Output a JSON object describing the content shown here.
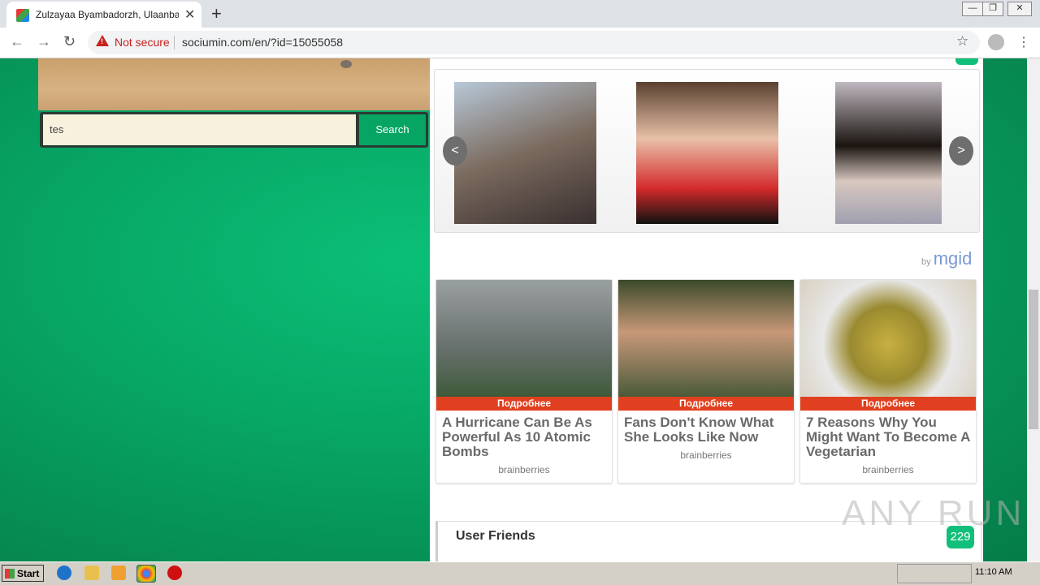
{
  "browser": {
    "tab_title": "Zulzayaa Byambadorzh, Ulaanbaatar",
    "tab_close": "✕",
    "new_tab": "+",
    "security_label": "Not secure",
    "url": "sociumin.com/en/?id=15055058"
  },
  "search": {
    "input_value": "tes",
    "button_label": "Search"
  },
  "carousel": {
    "prev": "<",
    "next": ">"
  },
  "ads": {
    "by_label": "by",
    "brand": "mgid",
    "cards": [
      {
        "cta": "Подробнее",
        "headline": "A Hurricane Can Be As Powerful As 10 Atomic Bombs",
        "source": "brainberries"
      },
      {
        "cta": "Подробнее",
        "headline": "Fans Don't Know What She Looks Like Now",
        "source": "brainberries"
      },
      {
        "cta": "Подробнее",
        "headline": "7 Reasons Why You Might Want To Become A Vegetarian",
        "source": "brainberries"
      }
    ]
  },
  "friends": {
    "label": "User Friends",
    "count": "229"
  },
  "watermark": "ANY RUN",
  "taskbar": {
    "start_label": "Start",
    "clock": "11:10 AM"
  }
}
